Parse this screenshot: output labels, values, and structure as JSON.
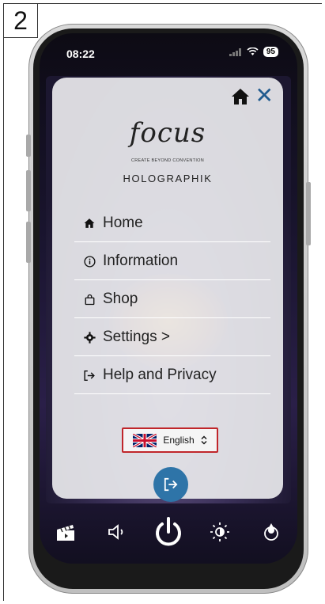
{
  "step": {
    "number": "2"
  },
  "status_bar": {
    "time": "08:22",
    "battery": "95"
  },
  "menu": {
    "logo_word": "focus",
    "logo_tagline": "CREATE BEYOND CONVENTION",
    "logo_subtitle": "HOLOGRAPHIK",
    "items": [
      {
        "label": "Home",
        "icon": "home-icon"
      },
      {
        "label": "Information",
        "icon": "info-icon"
      },
      {
        "label": "Shop",
        "icon": "shopping-bag-icon"
      },
      {
        "label": "Settings >",
        "icon": "gear-icon"
      },
      {
        "label": "Help and Privacy",
        "icon": "sign-out-icon"
      }
    ],
    "language": {
      "selected": "English"
    }
  },
  "controls": [
    "clapperboard-icon",
    "volume-icon",
    "power-icon",
    "brightness-icon",
    "flame-icon"
  ],
  "colors": {
    "accent_blue": "#2e74a8",
    "highlight_red": "#c0262b",
    "panel_bg": "#e8e8ec"
  }
}
